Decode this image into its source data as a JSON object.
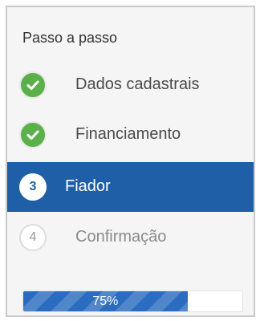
{
  "wizard": {
    "title": "Passo a passo",
    "steps": [
      {
        "label": "Dados cadastrais",
        "status": "done",
        "icon": "check-icon"
      },
      {
        "label": "Financiamento",
        "status": "done",
        "icon": "check-icon"
      },
      {
        "label": "Fiador",
        "status": "active",
        "number": "3"
      },
      {
        "label": "Confirmação",
        "status": "pending",
        "number": "4"
      }
    ],
    "progress": {
      "value": 0.75,
      "label": "75%"
    }
  },
  "colors": {
    "accent": "#1f5fa8",
    "done": "#5ab14a",
    "progress": "#2a6cbf"
  }
}
